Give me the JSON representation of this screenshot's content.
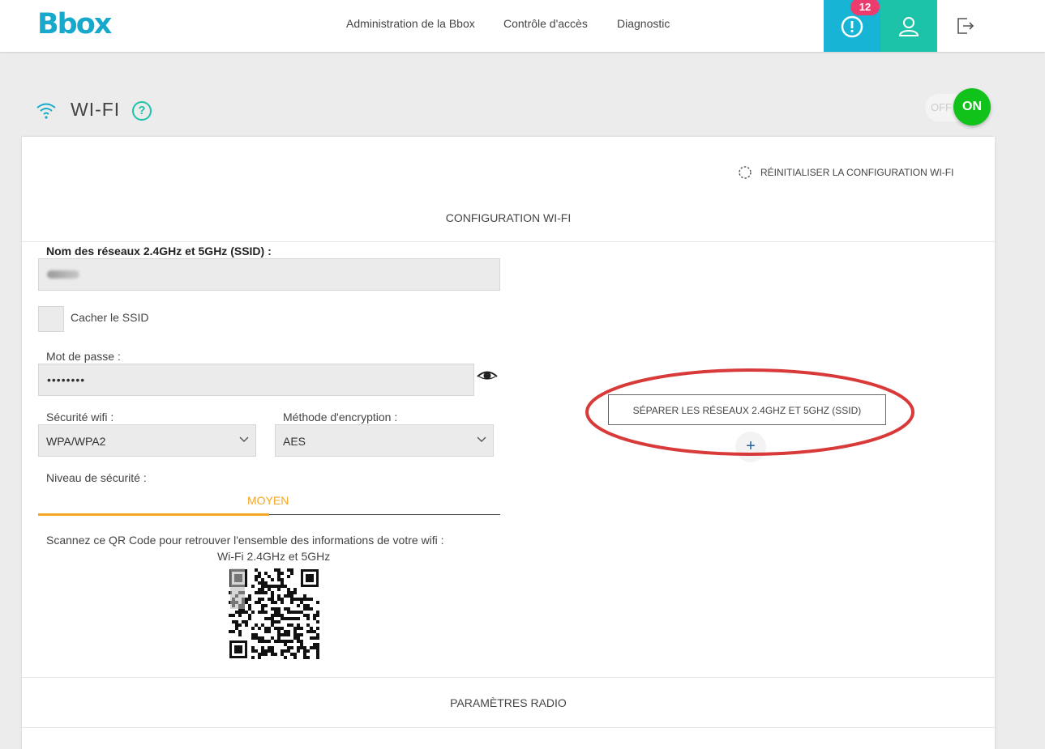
{
  "header": {
    "logo": "Bbox",
    "nav": [
      "Administration de la Bbox",
      "Contrôle d'accès",
      "Diagnostic"
    ],
    "alert_count": "12",
    "icons": [
      "alert-icon",
      "user-icon",
      "logout-icon"
    ]
  },
  "page": {
    "title": "WI-FI",
    "help": "?",
    "toggle_off": "OFF",
    "toggle_on": "ON"
  },
  "config": {
    "reset_label": "RÉINITIALISER LA CONFIGURATION WI-FI",
    "section_title": "CONFIGURATION WI-FI",
    "ssid_label": "Nom des réseaux 2.4GHz et 5GHz (SSID) :",
    "hide_ssid_label": "Cacher le SSID",
    "password_label": "Mot de passe :",
    "password_value": "••••••••",
    "security_label": "Sécurité wifi :",
    "security_value": "WPA/WPA2",
    "encryption_label": "Méthode d'encryption :",
    "encryption_value": "AES",
    "level_label": "Niveau de sécurité :",
    "level_value": "MOYEN",
    "level_fraction": 0.5,
    "qr_text": "Scannez ce QR Code pour retrouver l'ensemble des informations de votre wifi :",
    "qr_subtitle": "Wi-Fi 2.4GHz et 5GHz",
    "separate_button": "SÉPARER LES RÉSEAUX 2.4GHZ ET 5GHZ (SSID)",
    "add_button": "+"
  },
  "radio": {
    "section_title": "PARAMÈTRES RADIO"
  },
  "colors": {
    "brand": "#16a9cc",
    "teal": "#1dc3a8",
    "on_green": "#11c21b",
    "level_orange": "#f5a623",
    "badge_pink": "#ec3c6d",
    "annotation_red": "#d83a3a"
  }
}
